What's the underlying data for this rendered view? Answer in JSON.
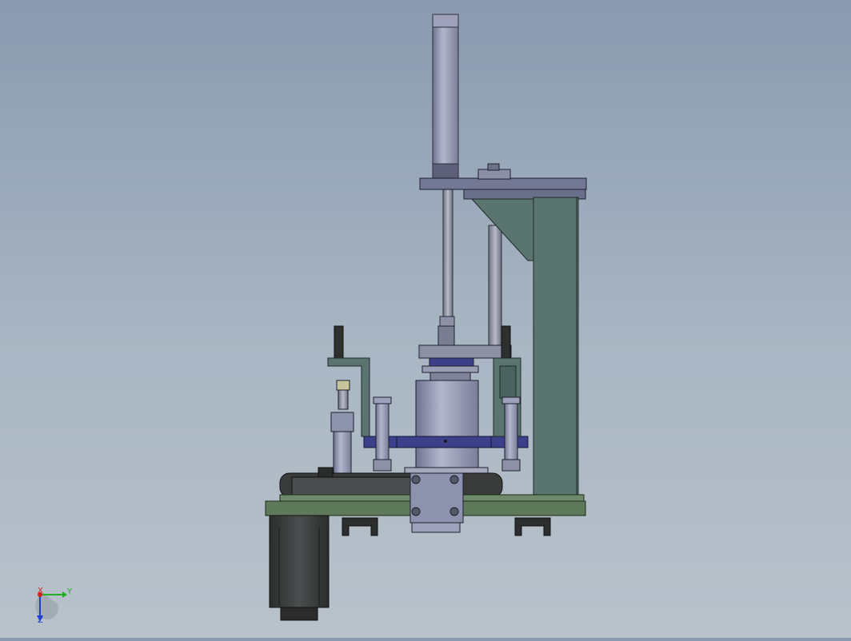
{
  "viewport": {
    "background_top": "#8a9bb0",
    "background_bottom": "#b9c2cb"
  },
  "colors": {
    "base_plate": "#5f7a5a",
    "column": "#5a7470",
    "top_plate": "#737894",
    "cylinder": "#8e93ad",
    "blue_plate": "#3c3f8a",
    "motor": "#3a3d3d",
    "bracket": "#5a7470",
    "foot": "#2c2e2e"
  },
  "triad": {
    "x_label": "X",
    "y_label": "Y",
    "z_label": "Z",
    "x_color": "#d02020",
    "y_color": "#20b020",
    "z_color": "#2040d0"
  }
}
